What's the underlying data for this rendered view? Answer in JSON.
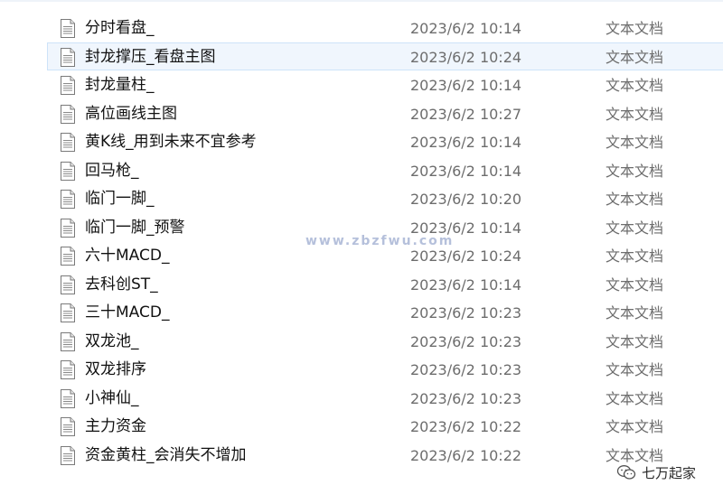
{
  "files": [
    {
      "name": "分时看盘_",
      "date": "2023/6/2 10:14",
      "type": "文本文档",
      "selected": false
    },
    {
      "name": "封龙撑压_看盘主图",
      "date": "2023/6/2 10:24",
      "type": "文本文档",
      "selected": true
    },
    {
      "name": "封龙量柱_",
      "date": "2023/6/2 10:14",
      "type": "文本文档",
      "selected": false
    },
    {
      "name": "高位画线主图",
      "date": "2023/6/2 10:27",
      "type": "文本文档",
      "selected": false
    },
    {
      "name": "黄K线_用到未来不宜参考",
      "date": "2023/6/2 10:14",
      "type": "文本文档",
      "selected": false
    },
    {
      "name": "回马枪_",
      "date": "2023/6/2 10:14",
      "type": "文本文档",
      "selected": false
    },
    {
      "name": "临门一脚_",
      "date": "2023/6/2 10:20",
      "type": "文本文档",
      "selected": false
    },
    {
      "name": "临门一脚_预警",
      "date": "2023/6/2 10:14",
      "type": "文本文档",
      "selected": false
    },
    {
      "name": "六十MACD_",
      "date": "2023/6/2 10:24",
      "type": "文本文档",
      "selected": false
    },
    {
      "name": "去科创ST_",
      "date": "2023/6/2 10:14",
      "type": "文本文档",
      "selected": false
    },
    {
      "name": "三十MACD_",
      "date": "2023/6/2 10:23",
      "type": "文本文档",
      "selected": false
    },
    {
      "name": "双龙池_",
      "date": "2023/6/2 10:23",
      "type": "文本文档",
      "selected": false
    },
    {
      "name": "双龙排序",
      "date": "2023/6/2 10:23",
      "type": "文本文档",
      "selected": false
    },
    {
      "name": "小神仙_",
      "date": "2023/6/2 10:23",
      "type": "文本文档",
      "selected": false
    },
    {
      "name": "主力资金",
      "date": "2023/6/2 10:22",
      "type": "文本文档",
      "selected": false
    },
    {
      "name": "资金黄柱_会消失不增加",
      "date": "2023/6/2 10:22",
      "type": "文本文档",
      "selected": false
    }
  ],
  "file_icon": "text-document-icon",
  "watermark": "www.zbzfwu.com",
  "brand": {
    "label": "七万起家",
    "icon": "wechat-official-account-icon"
  },
  "colors": {
    "selection_bg": "#f0f6fd",
    "selection_border": "#cde3f9",
    "watermark": "#788cbe"
  }
}
